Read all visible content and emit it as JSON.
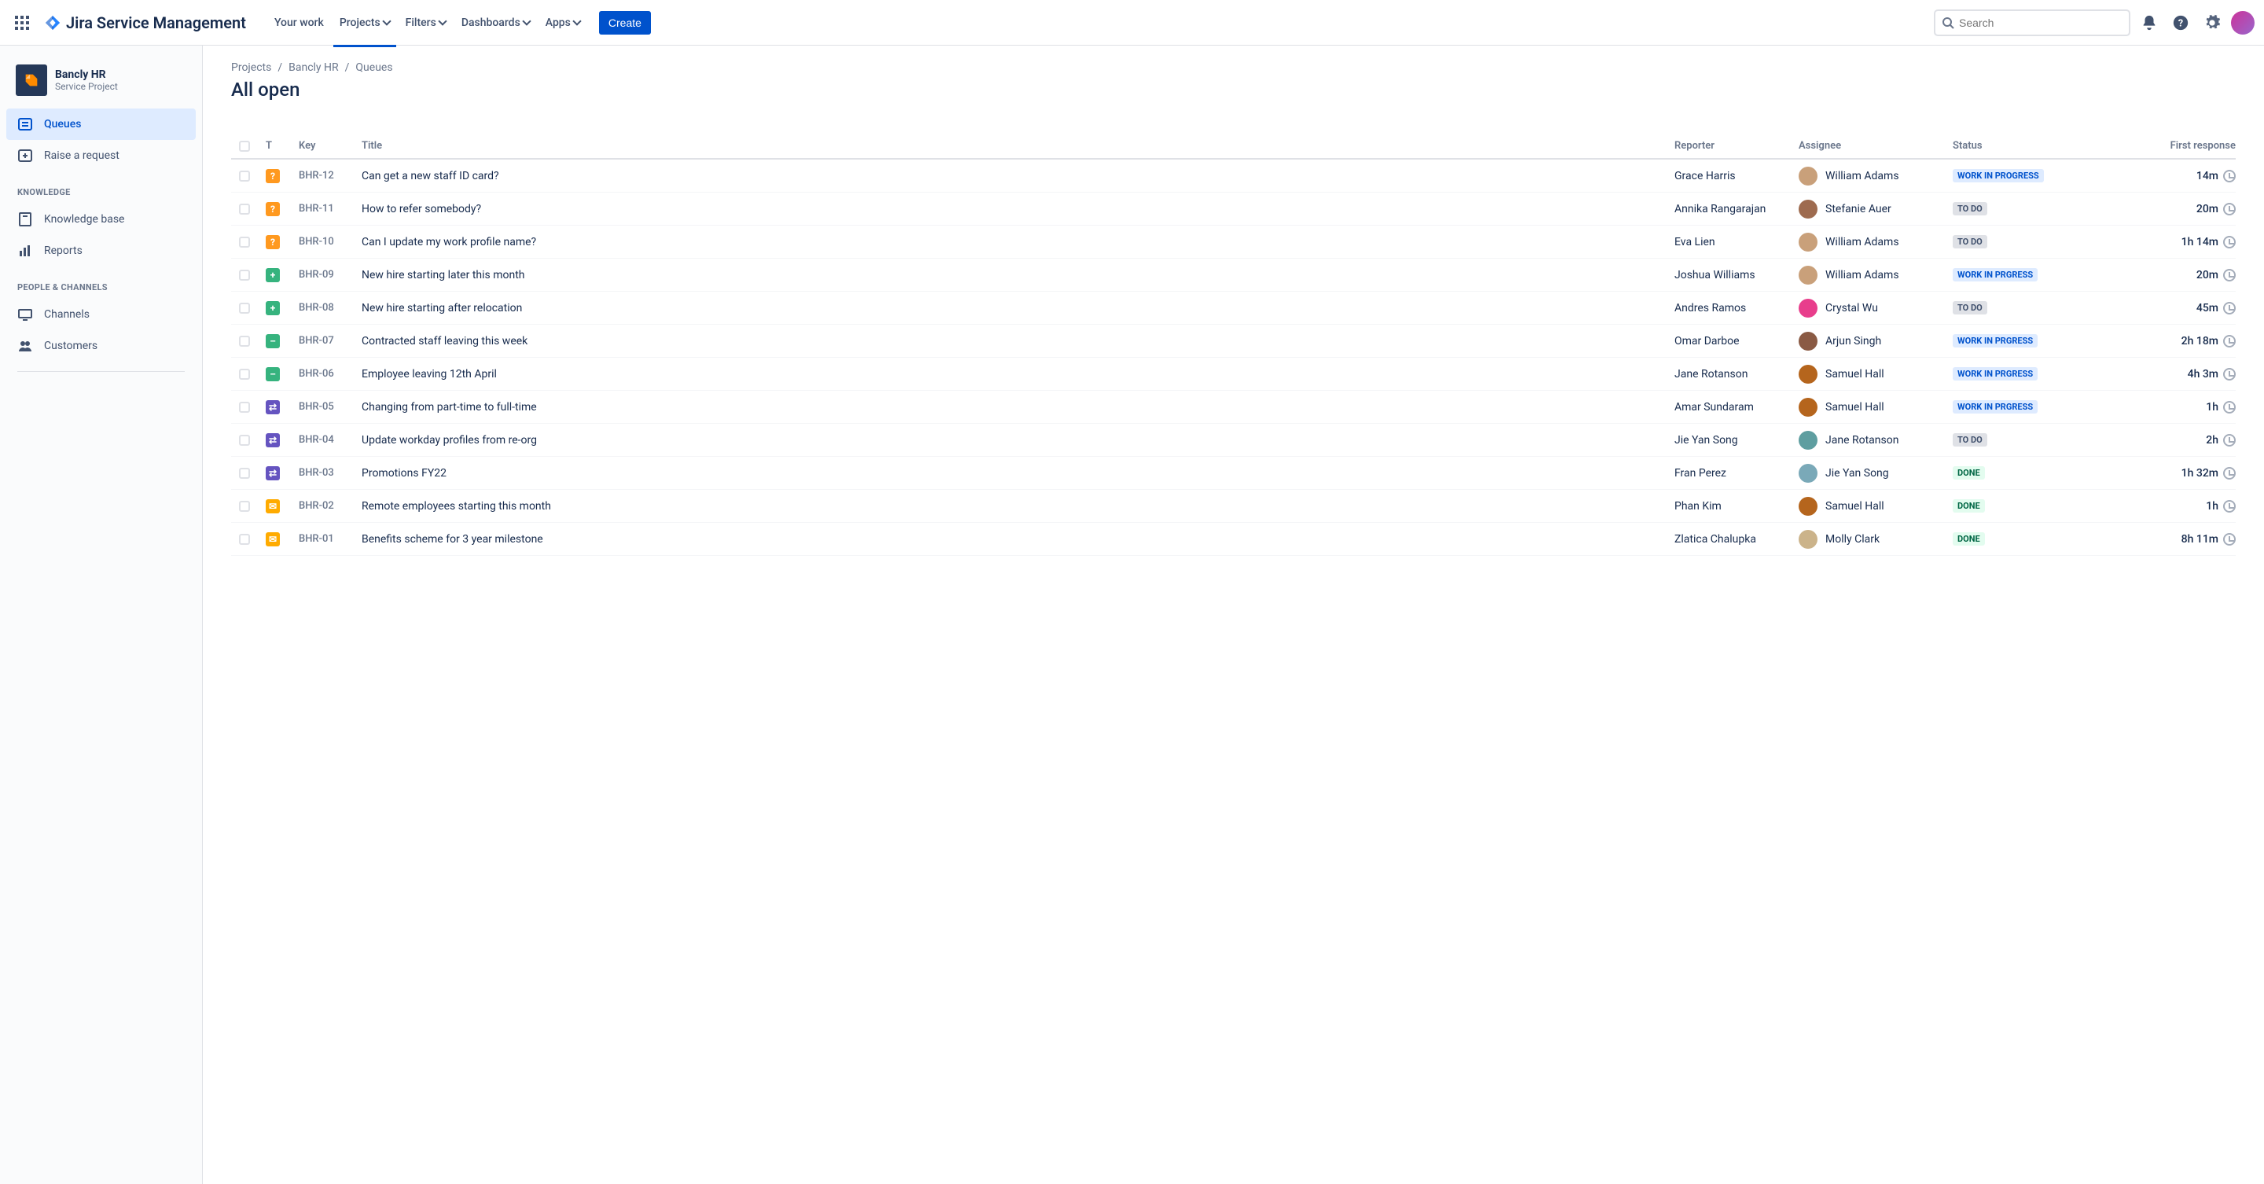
{
  "header": {
    "product": "Jira Service Management",
    "nav": {
      "your_work": "Your work",
      "projects": "Projects",
      "filters": "Filters",
      "dashboards": "Dashboards",
      "apps": "Apps"
    },
    "create": "Create",
    "search_placeholder": "Search"
  },
  "sidebar": {
    "project_name": "Bancly HR",
    "project_type": "Service Project",
    "items": {
      "queues": "Queues",
      "raise": "Raise a request"
    },
    "section_knowledge": "KNOWLEDGE",
    "kb": "Knowledge base",
    "reports": "Reports",
    "section_people": "PEOPLE & CHANNELS",
    "channels": "Channels",
    "customers": "Customers"
  },
  "breadcrumb": {
    "a": "Projects",
    "b": "Bancly HR",
    "c": "Queues"
  },
  "page_title": "All open",
  "columns": {
    "t": "T",
    "key": "Key",
    "title": "Title",
    "reporter": "Reporter",
    "assignee": "Assignee",
    "status": "Status",
    "first": "First response"
  },
  "status_labels": {
    "wip": "WORK IN PROGRESS",
    "wip2": "WORK IN PRGRESS",
    "todo": "TO DO",
    "done": "DONE"
  },
  "rows": [
    {
      "type": "q",
      "type_char": "?",
      "key": "BHR-12",
      "title": "Can get a new staff ID card?",
      "reporter": "Grace Harris",
      "assignee": "William Adams",
      "status": "wip",
      "avcolor": "#c9a07a",
      "resp": "14m"
    },
    {
      "type": "q",
      "type_char": "?",
      "key": "BHR-11",
      "title": "How to refer somebody?",
      "reporter": "Annika Rangarajan",
      "assignee": "Stefanie Auer",
      "status": "todo",
      "avcolor": "#9e6b4f",
      "resp": "20m"
    },
    {
      "type": "q",
      "type_char": "?",
      "key": "BHR-10",
      "title": "Can I update my work profile name?",
      "reporter": "Eva Lien",
      "assignee": "William Adams",
      "status": "todo",
      "avcolor": "#c9a07a",
      "resp": "1h 14m"
    },
    {
      "type": "p",
      "type_char": "+",
      "key": "BHR-09",
      "title": "New hire starting later this month",
      "reporter": "Joshua Williams",
      "assignee": "William Adams",
      "status": "wip2",
      "avcolor": "#c9a07a",
      "resp": "20m"
    },
    {
      "type": "p",
      "type_char": "+",
      "key": "BHR-08",
      "title": "New hire starting after relocation",
      "reporter": "Andres Ramos",
      "assignee": "Crystal Wu",
      "status": "todo",
      "avcolor": "#e83e8c",
      "resp": "45m"
    },
    {
      "type": "m",
      "type_char": "–",
      "key": "BHR-07",
      "title": "Contracted staff leaving this week",
      "reporter": "Omar Darboe",
      "assignee": "Arjun Singh",
      "status": "wip2",
      "avcolor": "#8a5a44",
      "resp": "2h 18m"
    },
    {
      "type": "m",
      "type_char": "–",
      "key": "BHR-06",
      "title": "Employee leaving 12th April",
      "reporter": "Jane Rotanson",
      "assignee": "Samuel Hall",
      "status": "wip2",
      "avcolor": "#b5651d",
      "resp": "4h 3m"
    },
    {
      "type": "c",
      "type_char": "⇄",
      "key": "BHR-05",
      "title": "Changing from part-time to full-time",
      "reporter": "Amar Sundaram",
      "assignee": "Samuel Hall",
      "status": "wip2",
      "avcolor": "#b5651d",
      "resp": "1h"
    },
    {
      "type": "c",
      "type_char": "⇄",
      "key": "BHR-04",
      "title": "Update workday profiles from re-org",
      "reporter": "Jie Yan Song",
      "assignee": "Jane Rotanson",
      "status": "todo",
      "avcolor": "#5e9ea0",
      "resp": "2h"
    },
    {
      "type": "c",
      "type_char": "⇄",
      "key": "BHR-03",
      "title": "Promotions FY22",
      "reporter": "Fran Perez",
      "assignee": "Jie Yan Song",
      "status": "done",
      "avcolor": "#7aa9b8",
      "resp": "1h 32m"
    },
    {
      "type": "e",
      "type_char": "✉",
      "key": "BHR-02",
      "title": "Remote employees starting this month",
      "reporter": "Phan Kim",
      "assignee": "Samuel Hall",
      "status": "done",
      "avcolor": "#b5651d",
      "resp": "1h"
    },
    {
      "type": "e",
      "type_char": "✉",
      "key": "BHR-01",
      "title": "Benefits scheme for 3 year milestone",
      "reporter": "Zlatica Chalupka",
      "assignee": "Molly Clark",
      "status": "done",
      "avcolor": "#cbb38a",
      "resp": "8h 11m"
    }
  ]
}
